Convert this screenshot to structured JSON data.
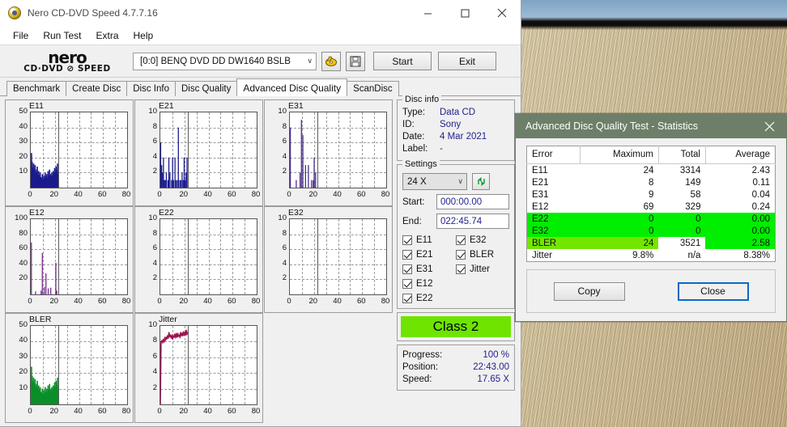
{
  "window": {
    "title": "Nero CD-DVD Speed 4.7.7.16",
    "icon": "nero-disc-icon",
    "minimize_label": "−",
    "maximize_label": "□",
    "close_label": "✕"
  },
  "menu": {
    "items": [
      "File",
      "Run Test",
      "Extra",
      "Help"
    ]
  },
  "toolbar": {
    "logo_line1": "nero",
    "logo_line2": "CD·DVD ⊘ SPEED",
    "drive": "[0:0]   BENQ DVD DD DW1640 BSLB",
    "drive_caret": "∨",
    "eject_icon": "disc-eject-icon",
    "save_icon": "floppy-save-icon",
    "start_label": "Start",
    "exit_label": "Exit"
  },
  "tabs": [
    {
      "label": "Benchmark",
      "active": false
    },
    {
      "label": "Create Disc",
      "active": false
    },
    {
      "label": "Disc Info",
      "active": false
    },
    {
      "label": "Disc Quality",
      "active": false
    },
    {
      "label": "Advanced Disc Quality",
      "active": true
    },
    {
      "label": "ScanDisc",
      "active": false
    }
  ],
  "disc_info": {
    "legend": "Disc info",
    "rows": [
      {
        "key": "Type:",
        "value": "Data CD"
      },
      {
        "key": "ID:",
        "value": "Sony"
      },
      {
        "key": "Date:",
        "value": "4 Mar 2021"
      },
      {
        "key": "Label:",
        "value": "-"
      }
    ]
  },
  "settings": {
    "legend": "Settings",
    "speed": "24 X",
    "speed_caret": "∨",
    "refresh_icon": "refresh-speed-icon",
    "start_label": "Start:",
    "start_value": "000:00.00",
    "end_label": "End:",
    "end_value": "022:45.74",
    "checkboxes": [
      {
        "label": "E11",
        "checked": true
      },
      {
        "label": "E32",
        "checked": true
      },
      {
        "label": "E21",
        "checked": true
      },
      {
        "label": "BLER",
        "checked": true
      },
      {
        "label": "E31",
        "checked": true
      },
      {
        "label": "Jitter",
        "checked": true
      },
      {
        "label": "E12",
        "checked": true
      },
      {
        "label": "",
        "checked": false
      },
      {
        "label": "E22",
        "checked": true
      },
      {
        "label": "",
        "checked": false
      }
    ]
  },
  "quality": {
    "class_label": "Class 2",
    "class_color": "#6ee400"
  },
  "status": {
    "rows": [
      {
        "key": "Progress:",
        "value": "100 %"
      },
      {
        "key": "Position:",
        "value": "22:43.00"
      },
      {
        "key": "Speed:",
        "value": "17.65 X"
      }
    ]
  },
  "stats_dialog": {
    "title": "Advanced Disc Quality Test - Statistics",
    "close_icon": "close-icon",
    "headers": [
      "Error",
      "Maximum",
      "Total",
      "Average"
    ],
    "rows": [
      {
        "label": "E11",
        "maximum": "24",
        "total": "3314",
        "average": "2.43",
        "highlight": "none"
      },
      {
        "label": "E21",
        "maximum": "8",
        "total": "149",
        "average": "0.11",
        "highlight": "none"
      },
      {
        "label": "E31",
        "maximum": "9",
        "total": "58",
        "average": "0.04",
        "highlight": "none"
      },
      {
        "label": "E12",
        "maximum": "69",
        "total": "329",
        "average": "0.24",
        "highlight": "none"
      },
      {
        "label": "E22",
        "maximum": "0",
        "total": "0",
        "average": "0.00",
        "highlight": "full"
      },
      {
        "label": "E32",
        "maximum": "0",
        "total": "0",
        "average": "0.00",
        "highlight": "full"
      },
      {
        "label": "BLER",
        "maximum": "24",
        "total": "3521",
        "average": "2.58",
        "highlight": "split"
      },
      {
        "label": "Jitter",
        "maximum": "9.8%",
        "total": "n/a",
        "average": "8.38%",
        "highlight": "none"
      }
    ],
    "copy_label": "Copy",
    "close_label": "Close"
  },
  "chart_data": [
    {
      "type": "area",
      "title": "E11",
      "color": "#1b1b8f",
      "xlabel": "",
      "ylabel": "",
      "xlim": [
        0,
        80
      ],
      "ylim": [
        0,
        50
      ],
      "xticks": [
        0,
        20,
        40,
        60,
        80
      ],
      "yticks": [
        10,
        20,
        30,
        40,
        50
      ],
      "grid": true,
      "marker_x": 22.7,
      "x": [
        0,
        0.6,
        1.2,
        1.8,
        2.4,
        3,
        3.6,
        4.2,
        4.8,
        5.4,
        6,
        6.6,
        7.2,
        7.8,
        8.4,
        9,
        9.6,
        10.2,
        10.8,
        11.4,
        12,
        12.6,
        13.2,
        13.8,
        14.4,
        15,
        15.6,
        16.2,
        16.8,
        17.4,
        18,
        18.6,
        19.2,
        19.8,
        20.4,
        21,
        21.6,
        22.2,
        22.7
      ],
      "values": [
        10,
        23,
        17,
        13,
        16,
        11,
        15,
        10,
        12,
        14,
        9,
        11,
        8,
        10,
        7,
        6,
        9,
        5,
        8,
        6,
        10,
        7,
        9,
        6,
        11,
        8,
        12,
        9,
        7,
        10,
        8,
        11,
        9,
        13,
        10,
        14,
        11,
        16,
        9
      ]
    },
    {
      "type": "bar",
      "title": "E21",
      "color": "#1b1b8f",
      "xlabel": "",
      "ylabel": "",
      "xlim": [
        0,
        80
      ],
      "ylim": [
        0,
        10
      ],
      "xticks": [
        0,
        20,
        40,
        60,
        80
      ],
      "yticks": [
        2,
        4,
        6,
        8,
        10
      ],
      "grid": true,
      "marker_x": 22.7,
      "x": [
        0.3,
        1.1,
        1.9,
        2.6,
        3.4,
        4.2,
        5.0,
        6.3,
        7.1,
        8.0,
        9.4,
        10.2,
        11.0,
        12.2,
        13.0,
        14.1,
        15.0,
        16.2,
        17.0,
        18.1,
        19.0,
        19.8,
        20.6,
        21.4,
        22.2
      ],
      "values": [
        6,
        3,
        2,
        4,
        1,
        1,
        2,
        1,
        4,
        2,
        1,
        4,
        1,
        4,
        1,
        1,
        8,
        1,
        1,
        2,
        1,
        4,
        1,
        2,
        4
      ]
    },
    {
      "type": "bar",
      "title": "E31",
      "color": "#4b2d8f",
      "xlabel": "",
      "ylabel": "",
      "xlim": [
        0,
        80
      ],
      "ylim": [
        0,
        10
      ],
      "xticks": [
        0,
        20,
        40,
        60,
        80
      ],
      "yticks": [
        2,
        4,
        6,
        8,
        10
      ],
      "grid": true,
      "marker_x": 22.7,
      "x": [
        0.4,
        5.3,
        8.5,
        9.6,
        10.8,
        13.0,
        15.4,
        18.0,
        19.4,
        20.2,
        21.4
      ],
      "values": [
        8,
        1,
        2,
        9,
        7,
        3,
        3,
        1,
        1,
        4,
        2
      ]
    },
    {
      "type": "bar",
      "title": "E12",
      "color": "#7b2d8f",
      "xlabel": "",
      "ylabel": "",
      "xlim": [
        0,
        80
      ],
      "ylim": [
        0,
        100
      ],
      "xticks": [
        0,
        20,
        40,
        60,
        80
      ],
      "yticks": [
        20,
        40,
        60,
        80,
        100
      ],
      "grid": true,
      "marker_x": 22.7,
      "x": [
        0.5,
        4.0,
        8.6,
        9.6,
        11.3,
        12.6,
        14.5,
        16.6,
        20.8,
        21.6
      ],
      "values": [
        69,
        4,
        5,
        55,
        10,
        28,
        8,
        9,
        42,
        5
      ]
    },
    {
      "type": "bar",
      "title": "E22",
      "color": "#1b1b8f",
      "xlabel": "",
      "ylabel": "",
      "xlim": [
        0,
        80
      ],
      "ylim": [
        0,
        10
      ],
      "xticks": [
        0,
        20,
        40,
        60,
        80
      ],
      "yticks": [
        2,
        4,
        6,
        8,
        10
      ],
      "grid": true,
      "marker_x": 22.7,
      "x": [],
      "values": []
    },
    {
      "type": "bar",
      "title": "E32",
      "color": "#1b1b8f",
      "xlabel": "",
      "ylabel": "",
      "xlim": [
        0,
        80
      ],
      "ylim": [
        0,
        10
      ],
      "xticks": [
        0,
        20,
        40,
        60,
        80
      ],
      "yticks": [
        2,
        4,
        6,
        8,
        10
      ],
      "grid": true,
      "marker_x": 22.7,
      "x": [],
      "values": []
    },
    {
      "type": "area",
      "title": "BLER",
      "color": "#0a8f28",
      "xlabel": "",
      "ylabel": "",
      "xlim": [
        0,
        80
      ],
      "ylim": [
        0,
        50
      ],
      "xticks": [
        0,
        20,
        40,
        60,
        80
      ],
      "yticks": [
        10,
        20,
        30,
        40,
        50
      ],
      "grid": true,
      "marker_x": 22.7,
      "x": [
        0,
        0.6,
        1.2,
        1.8,
        2.4,
        3,
        3.6,
        4.2,
        4.8,
        5.4,
        6,
        6.6,
        7.2,
        7.8,
        8.4,
        9,
        9.6,
        10.2,
        10.8,
        11.4,
        12,
        12.6,
        13.2,
        13.8,
        14.4,
        15,
        15.6,
        16.2,
        16.8,
        17.4,
        18,
        18.6,
        19.2,
        19.8,
        20.4,
        21,
        21.6,
        22.2,
        22.7
      ],
      "values": [
        11,
        24,
        18,
        14,
        17,
        12,
        16,
        11,
        13,
        15,
        10,
        12,
        9,
        11,
        8,
        7,
        10,
        6,
        9,
        7,
        11,
        8,
        10,
        7,
        12,
        9,
        13,
        10,
        8,
        11,
        9,
        12,
        10,
        14,
        11,
        15,
        12,
        17,
        10
      ]
    },
    {
      "type": "line",
      "title": "Jitter",
      "color": "#9e1050",
      "xlabel": "",
      "ylabel": "",
      "xlim": [
        0,
        80
      ],
      "ylim": [
        0,
        10
      ],
      "xticks": [
        0,
        20,
        40,
        60,
        80
      ],
      "yticks": [
        2,
        4,
        6,
        8,
        10
      ],
      "grid": true,
      "marker_x": 22.7,
      "x": [
        0,
        0.6,
        1.2,
        1.8,
        2.4,
        3,
        3.6,
        4.2,
        4.8,
        5.4,
        6,
        6.6,
        7.2,
        7.8,
        8.4,
        9,
        9.6,
        10.2,
        10.8,
        11.4,
        12,
        12.6,
        13.2,
        13.8,
        14.4,
        15,
        15.6,
        16.2,
        16.8,
        17.4,
        18,
        18.6,
        19.2,
        19.8,
        20.4,
        21,
        21.6,
        22.2,
        22.7
      ],
      "values": [
        0,
        8.0,
        8.1,
        7.9,
        8.2,
        8.0,
        8.4,
        8.1,
        8.6,
        8.3,
        8.8,
        8.4,
        9.2,
        8.6,
        8.9,
        8.4,
        8.7,
        8.3,
        8.8,
        8.5,
        9.0,
        8.6,
        8.9,
        8.5,
        9.1,
        8.7,
        8.8,
        8.6,
        9.2,
        8.8,
        9.0,
        8.7,
        9.3,
        8.9,
        9.1,
        8.8,
        9.5,
        9.0,
        9.2
      ]
    }
  ]
}
